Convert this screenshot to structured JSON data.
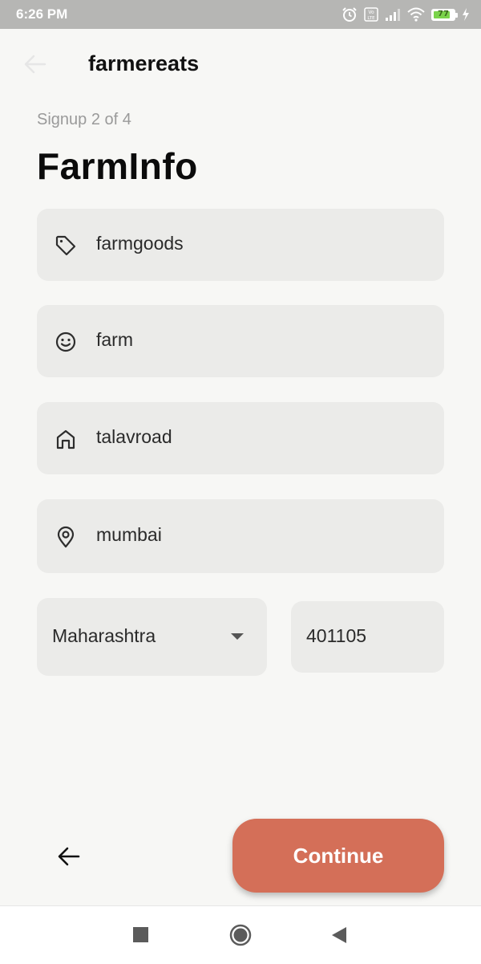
{
  "status_bar": {
    "time": "6:26 PM",
    "battery_level": "77",
    "icons": [
      "alarm-icon",
      "volte-icon",
      "signal-icon",
      "wifi-icon",
      "battery-icon",
      "charging-icon"
    ]
  },
  "app_bar": {
    "title": "farmereats",
    "back_icon": "arrow-left-icon"
  },
  "step_label": "Signup 2 of 4",
  "page_title": "FarmInfo",
  "fields": [
    {
      "icon": "tag-icon",
      "value": "farmgoods"
    },
    {
      "icon": "smiley-icon",
      "value": "farm"
    },
    {
      "icon": "home-icon",
      "value": "talavroad"
    },
    {
      "icon": "location-pin-icon",
      "value": "mumbai"
    }
  ],
  "state_select": {
    "value": "Maharashtra",
    "icon": "caret-down-icon"
  },
  "zip_field": {
    "value": "401105"
  },
  "footer": {
    "back_icon": "arrow-left-icon",
    "continue_label": "Continue"
  },
  "colors": {
    "accent": "#d46f58",
    "background": "#f7f7f5",
    "field_bg": "#ebebe9"
  }
}
